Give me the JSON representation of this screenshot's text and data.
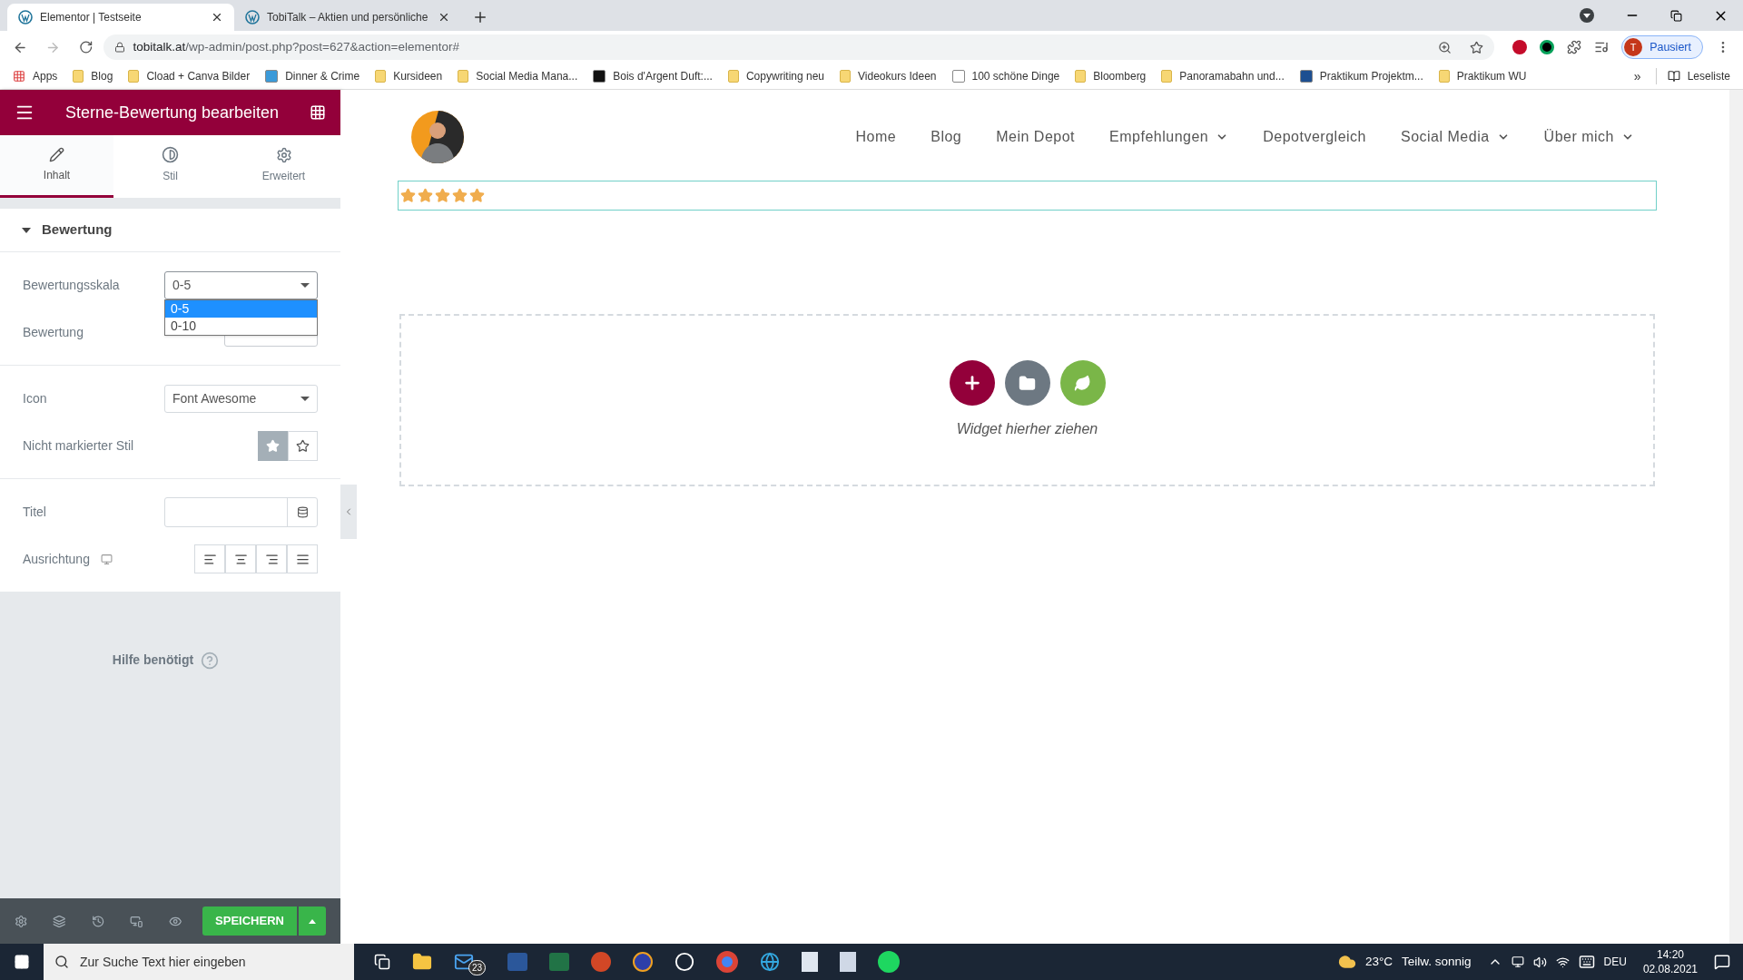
{
  "browser": {
    "tabs": [
      {
        "title": "Elementor | Testseite",
        "selected": true
      },
      {
        "title": "TobiTalk – Aktien und persönliche",
        "selected": false
      }
    ],
    "url_host": "tobitalk.at",
    "url_path": "/wp-admin/post.php?post=627&action=elementor#",
    "bookmarks": [
      {
        "label": "Apps",
        "kind": "apps"
      },
      {
        "label": "Blog",
        "kind": "folder"
      },
      {
        "label": "Cload + Canva Bilder",
        "kind": "folder"
      },
      {
        "label": "Dinner & Crime",
        "kind": "site",
        "color": "#3b9ad9"
      },
      {
        "label": "Kursideen",
        "kind": "folder"
      },
      {
        "label": "Social Media Mana...",
        "kind": "folder"
      },
      {
        "label": "Bois d'Argent Duft:...",
        "kind": "site",
        "color": "#111111"
      },
      {
        "label": "Copywriting neu",
        "kind": "folder"
      },
      {
        "label": "Videokurs Ideen",
        "kind": "folder"
      },
      {
        "label": "100 schöne Dinge",
        "kind": "site",
        "color": "#ffffff"
      },
      {
        "label": "Bloomberg",
        "kind": "folder"
      },
      {
        "label": "Panoramabahn und...",
        "kind": "folder"
      },
      {
        "label": "Praktikum Projektm...",
        "kind": "site",
        "color": "#1d4f91"
      },
      {
        "label": "Praktikum WU",
        "kind": "folder"
      }
    ],
    "more_bookmarks": "»",
    "profile_initial": "T",
    "profile_label": "Pausiert",
    "reading_list": "Leseliste"
  },
  "editor": {
    "title": "Sterne-Bewertung bearbeiten",
    "tabs": [
      {
        "label": "Inhalt",
        "kind": "pencil",
        "selected": true
      },
      {
        "label": "Stil",
        "kind": "contrast",
        "selected": false
      },
      {
        "label": "Erweitert",
        "kind": "gear",
        "selected": false
      }
    ],
    "section": {
      "title": "Bewertung",
      "expanded": true
    },
    "groups": [
      [
        {
          "kind": "select",
          "label": "Bewertungsskala",
          "value": "0-5",
          "open": true,
          "options": [
            {
              "label": "0-5",
              "selected": true
            },
            {
              "label": "0-10",
              "selected": false
            }
          ]
        },
        {
          "kind": "number",
          "label": "Bewertung"
        }
      ],
      [
        {
          "kind": "select",
          "label": "Icon",
          "value": "Font Awesome"
        },
        {
          "kind": "choice",
          "label": "Nicht markierter Stil",
          "options": [
            {
              "kind": "solid",
              "selected": true
            },
            {
              "kind": "outline",
              "selected": false
            }
          ]
        }
      ],
      [
        {
          "kind": "text",
          "label": "Titel"
        },
        {
          "kind": "align",
          "label": "Ausrichtung",
          "options": [
            {
              "kind": "left",
              "selected": false
            },
            {
              "kind": "center",
              "selected": false
            },
            {
              "kind": "right",
              "selected": false
            },
            {
              "kind": "justify",
              "selected": false
            }
          ]
        }
      ]
    ],
    "help": "Hilfe benötigt",
    "save": "SPEICHERN"
  },
  "canvas": {
    "nav": [
      {
        "label": "Home",
        "has_menu": false
      },
      {
        "label": "Blog",
        "has_menu": false
      },
      {
        "label": "Mein Depot",
        "has_menu": false
      },
      {
        "label": "Empfehlungen",
        "has_menu": true
      },
      {
        "label": "Depotvergleich",
        "has_menu": false
      },
      {
        "label": "Social Media",
        "has_menu": true
      },
      {
        "label": "Über mich",
        "has_menu": true
      }
    ],
    "rating": {
      "stars": 5
    },
    "dropzone": "Widget hierher ziehen"
  },
  "taskbar": {
    "search_placeholder": "Zur Suche Text hier eingeben",
    "mail_badge": "23",
    "temperature": "23°C",
    "weather": "Teilw. sonnig",
    "language": "DEU",
    "time": "14:20",
    "date": "02.08.2021"
  }
}
